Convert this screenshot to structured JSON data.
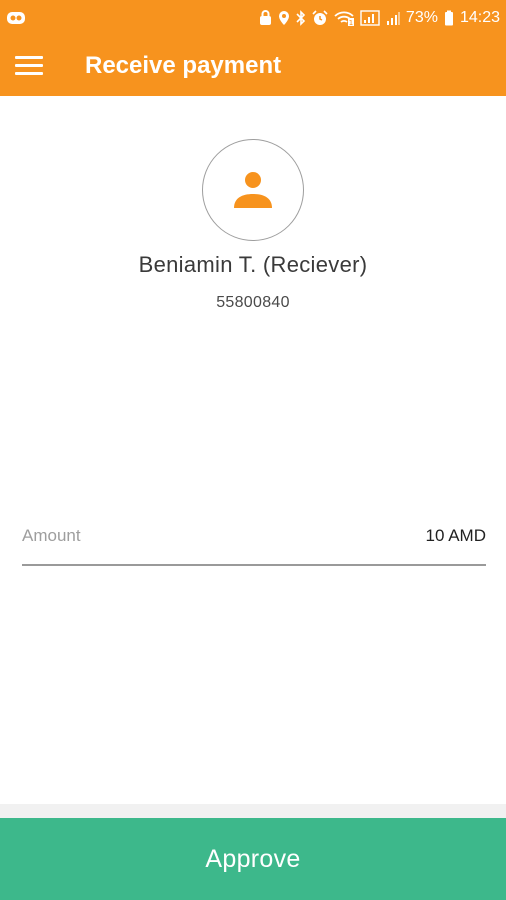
{
  "statusbar": {
    "battery_percent": "73%",
    "time": "14:23",
    "icons": [
      "go-icon",
      "lock-icon",
      "location-icon",
      "bluetooth-icon",
      "alarm-icon",
      "wifi-icon",
      "signal-icon",
      "signal-icon-2",
      "battery-icon"
    ]
  },
  "toolbar": {
    "title": "Receive payment",
    "menu_icon": "hamburger-menu-icon"
  },
  "profile": {
    "avatar_icon": "person-icon",
    "name": "Beniamin T. (Reciever)",
    "phone": "55800840"
  },
  "amount": {
    "label": "Amount",
    "value": "10 AMD"
  },
  "actions": {
    "approve_label": "Approve"
  },
  "colors": {
    "brand": "#F7931E",
    "approve": "#3DB88B"
  }
}
